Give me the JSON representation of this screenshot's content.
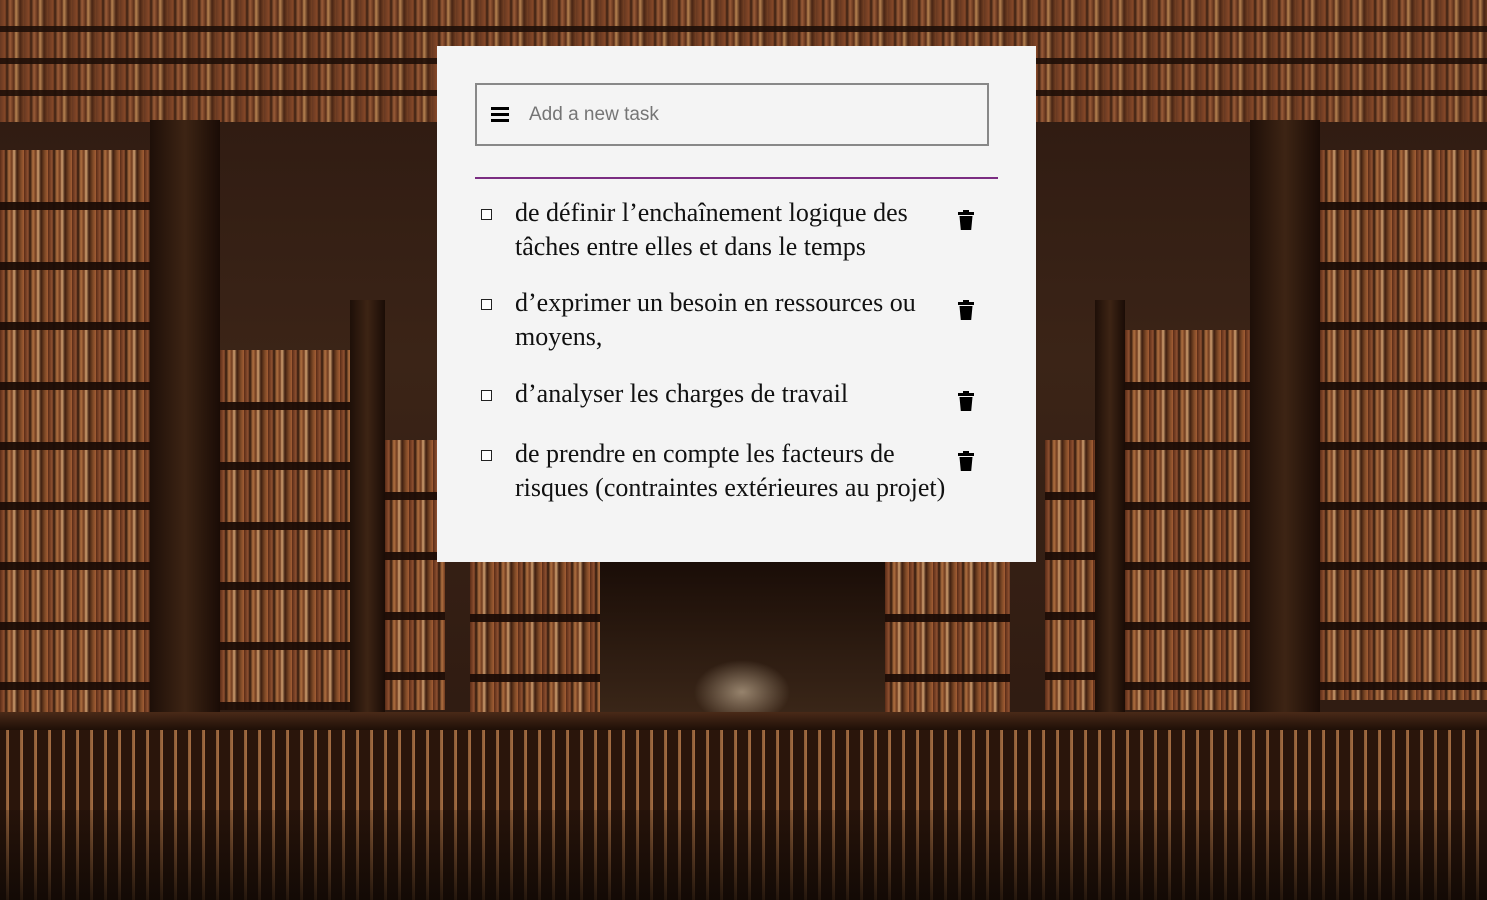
{
  "input": {
    "placeholder": "Add a new task",
    "value": ""
  },
  "tasks": [
    {
      "text": "de définir l’enchaînement logique des tâches entre elles et dans le temps",
      "checked": false
    },
    {
      "text": "d’exprimer un besoin en ressources ou moyens,",
      "checked": false
    },
    {
      "text": "d’analyser les charges de travail",
      "checked": false
    },
    {
      "text": "de prendre en compte les facteurs de risques (contraintes extérieures au projet)",
      "checked": false
    }
  ],
  "icons": {
    "menu": "hamburger-menu-icon",
    "delete": "trash-icon"
  },
  "colors": {
    "card_background": "#f4f4f4",
    "divider": "#7b2d82",
    "input_border": "#888888"
  }
}
